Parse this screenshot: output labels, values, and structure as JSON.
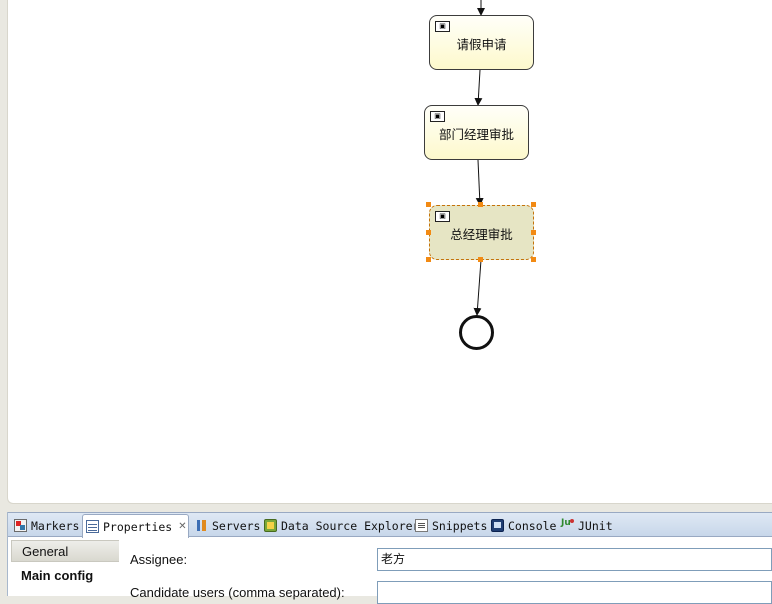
{
  "diagram": {
    "tasks": [
      {
        "label": "请假申请",
        "badge": "▣"
      },
      {
        "label": "部门经理审批",
        "badge": "▣"
      },
      {
        "label": "总经理审批",
        "badge": "▣"
      }
    ]
  },
  "tabs": [
    {
      "label": "Markers",
      "icon": "markers-icon"
    },
    {
      "label": "Properties",
      "icon": "properties-icon",
      "active": true,
      "close": "✕"
    },
    {
      "label": "Servers",
      "icon": "servers-icon"
    },
    {
      "label": "Data Source Explorer",
      "icon": "data-source-explorer-icon"
    },
    {
      "label": "Snippets",
      "icon": "snippets-icon"
    },
    {
      "label": "Console",
      "icon": "console-icon"
    },
    {
      "label": "JUnit",
      "icon": "junit-icon"
    }
  ],
  "properties": {
    "nav": [
      "General",
      "Main config"
    ],
    "fields": {
      "assignee_label": "Assignee:",
      "assignee_value": "老方",
      "candidate_users_label": "Candidate users (comma separated):",
      "candidate_users_value": ""
    }
  }
}
